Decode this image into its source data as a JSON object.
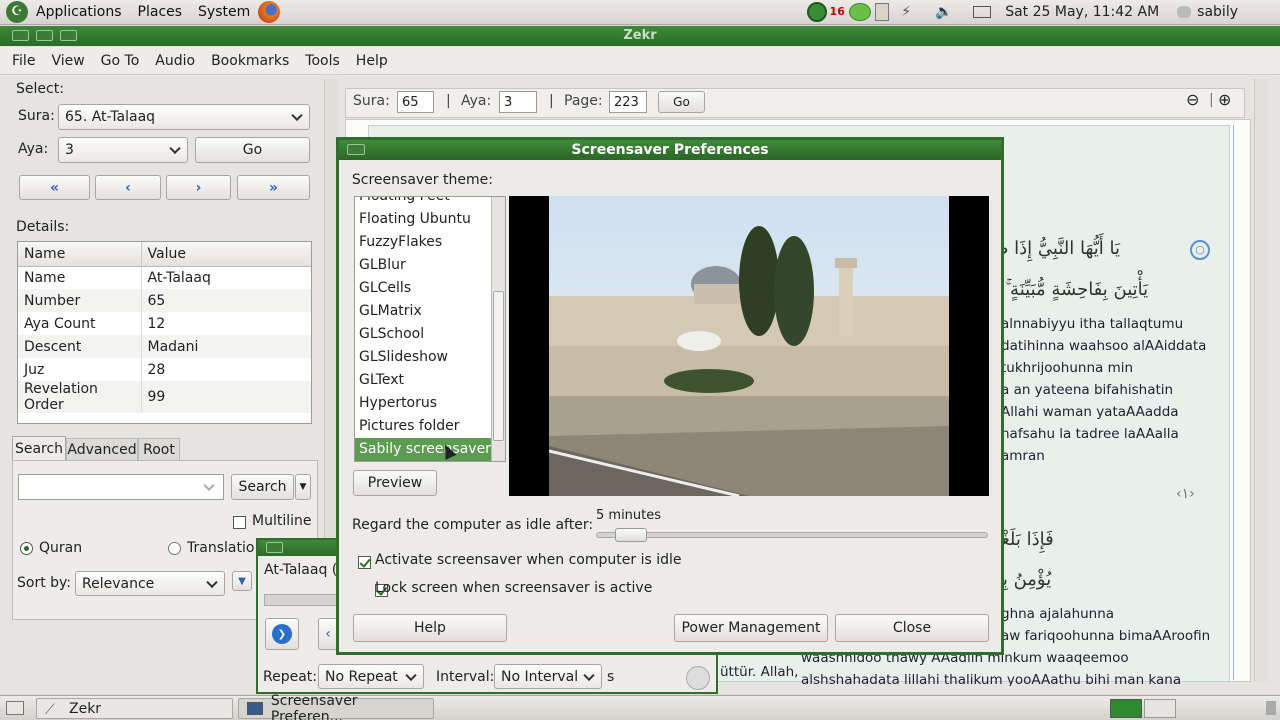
{
  "top_panel": {
    "menus": [
      "Applications",
      "Places",
      "System"
    ],
    "badge_count": "16",
    "clock": "Sat 25 May, 11:42 AM",
    "user": "sabily"
  },
  "main_window": {
    "title": "Zekr",
    "menu": [
      "File",
      "View",
      "Go To",
      "Audio",
      "Bookmarks",
      "Tools",
      "Help"
    ]
  },
  "left_panel": {
    "select_label": "Select:",
    "sura_label": "Sura:",
    "sura_value": "65. At-Talaaq",
    "aya_label": "Aya:",
    "aya_value": "3",
    "go_label": "Go",
    "nav_buttons": [
      "«",
      "‹",
      "›",
      "»"
    ],
    "details_label": "Details:",
    "details_headers": [
      "Name",
      "Value"
    ],
    "details_rows": [
      [
        "Name",
        "At-Talaaq"
      ],
      [
        "Number",
        "65"
      ],
      [
        "Aya Count",
        "12"
      ],
      [
        "Descent",
        "Madani"
      ],
      [
        "Juz",
        "28"
      ],
      [
        "Revelation Order",
        "99"
      ]
    ],
    "tabs": [
      "Search",
      "Advanced",
      "Root"
    ],
    "search_button": "Search",
    "multiline_label": "Multiline",
    "radio_quran": "Quran",
    "radio_translation": "Translatio",
    "sortby_label": "Sort by:",
    "sortby_value": "Relevance"
  },
  "navbar": {
    "sura_label": "Sura:",
    "sura_value": "65",
    "aya_label": "Aya:",
    "aya_value": "3",
    "page_label": "Page:",
    "page_value": "223",
    "go_label": "Go",
    "separator": "|"
  },
  "quran_view": {
    "arabic_lines": [
      "يَا أَيُّهَا النَّبِيُّ إِذَا طَلَّقْتُمُ النِّسَاءَ",
      "يَأْتِينَ بِفَاحِشَةٍ مُّبَيِّنَةٍ ۚ وَتِلْكَ حُدُودُ",
      "فَإِذَا بَلَغْنَ أَجَلَهُنَّ فَأَمْسِكُوهُنَّ بِمَعْرُ",
      "يُؤْمِنُ بِاللَّهِ وَالْيَوْمِ الْآخِرِ ۚ وَمَن يَتَّقِ"
    ],
    "translit_1": [
      "alnnabiyyu itha tallaqtumu",
      "datihinna waahsoo alAAiddata",
      "tukhrijoohunna min",
      "a an yateena bifahishatin",
      "Allahi waman yataAAadda",
      "nafsahu la tadree laAAalla",
      "amran"
    ],
    "aya_marker": "١",
    "translit_2": [
      "ghna ajalahunna",
      "aw fariqoohunna bimaAAroofin",
      "waashhidoo thawy AAadlin minkum waaqeemoo",
      "alshshahadata lillahi thalikum yooAAathu bihi man kana"
    ],
    "partial_text": "üttür. Allah,"
  },
  "audio_panel": {
    "title": "At-Talaaq (",
    "repeat_label": "Repeat:",
    "repeat_value": "No Repeat",
    "interval_label": "Interval:",
    "interval_value": "No Interval",
    "interval_unit": "s"
  },
  "dialog": {
    "title": "Screensaver Preferences",
    "theme_label": "Screensaver theme:",
    "themes": [
      "Floating Feet",
      "Floating Ubuntu",
      "FuzzyFlakes",
      "GLBlur",
      "GLCells",
      "GLMatrix",
      "GLSchool",
      "GLSlideshow",
      "GLText",
      "Hypertorus",
      "Pictures folder",
      "Sabily screensaver"
    ],
    "selected_theme": "Sabily screensaver",
    "preview_button": "Preview",
    "idle_label": "Regard the computer as idle after:",
    "idle_value": "5 minutes",
    "idle_fraction": 0.05,
    "check_activate": "Activate screensaver when computer is idle",
    "check_lock": "Lock screen when screensaver is active",
    "help_button": "Help",
    "power_button": "Power Management",
    "close_button": "Close"
  },
  "taskbar": {
    "tasks": [
      "Zekr",
      "Screensaver Preferen..."
    ]
  },
  "colors": {
    "title_green": "#2b6b27",
    "selection_green": "#5d9b52",
    "panel_gray": "#dcdad5"
  }
}
